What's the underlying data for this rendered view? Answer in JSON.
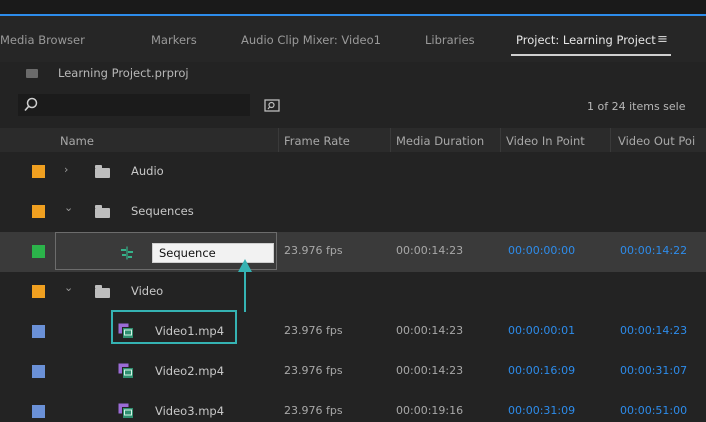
{
  "tabs": [
    {
      "label": "Media Browser",
      "active": false
    },
    {
      "label": "Markers",
      "active": false
    },
    {
      "label": "Audio Clip Mixer: Video1",
      "active": false
    },
    {
      "label": "Libraries",
      "active": false
    },
    {
      "label": "Project: Learning Project",
      "active": true
    }
  ],
  "menu_icon": "≡",
  "project": {
    "filename": "Learning Project.prproj"
  },
  "search": {
    "value": "",
    "placeholder": ""
  },
  "items_count": "1 of 24 items sele",
  "columns": [
    "Name",
    "Frame Rate",
    "Media Duration",
    "Video In Point",
    "Video Out Poi"
  ],
  "rows": [
    {
      "type": "folder",
      "name": "Audio",
      "expanded": false,
      "label_color": "#f0a020",
      "frame_rate": "",
      "media_duration": "",
      "in_point": "",
      "out_point": ""
    },
    {
      "type": "folder",
      "name": "Sequences",
      "expanded": true,
      "label_color": "#f0a020",
      "frame_rate": "",
      "media_duration": "",
      "in_point": "",
      "out_point": ""
    },
    {
      "type": "sequence",
      "name": "Sequence",
      "editing": true,
      "label_color": "#2bb34a",
      "frame_rate": "23.976 fps",
      "media_duration": "00:00:14:23",
      "in_point": "00:00:00:00",
      "out_point": "00:00:14:22"
    },
    {
      "type": "folder",
      "name": "Video",
      "expanded": true,
      "label_color": "#f0a020",
      "frame_rate": "",
      "media_duration": "",
      "in_point": "",
      "out_point": ""
    },
    {
      "type": "clip",
      "name": "Video1.mp4",
      "label_color": "#6a90d6",
      "frame_rate": "23.976 fps",
      "media_duration": "00:00:14:23",
      "in_point": "00:00:00:01",
      "out_point": "00:00:14:23"
    },
    {
      "type": "clip",
      "name": "Video2.mp4",
      "label_color": "#6a90d6",
      "frame_rate": "23.976 fps",
      "media_duration": "00:00:14:23",
      "in_point": "00:00:16:09",
      "out_point": "00:00:31:07"
    },
    {
      "type": "clip",
      "name": "Video3.mp4",
      "label_color": "#6a90d6",
      "frame_rate": "23.976 fps",
      "media_duration": "00:00:19:16",
      "in_point": "00:00:31:09",
      "out_point": "00:00:51:00"
    }
  ],
  "colors": {
    "accent_blue": "#2d8ceb",
    "callout": "#35b3b3",
    "folder_label": "#f0a020",
    "sequence_label": "#2bb34a",
    "clip_label": "#6a90d6"
  },
  "icons": {
    "folder": "folder-icon",
    "sequence": "sequence-icon",
    "clip": "video-clip-icon",
    "search": "search-icon",
    "new_bin": "new-bin-icon",
    "project_file": "project-file-icon"
  }
}
